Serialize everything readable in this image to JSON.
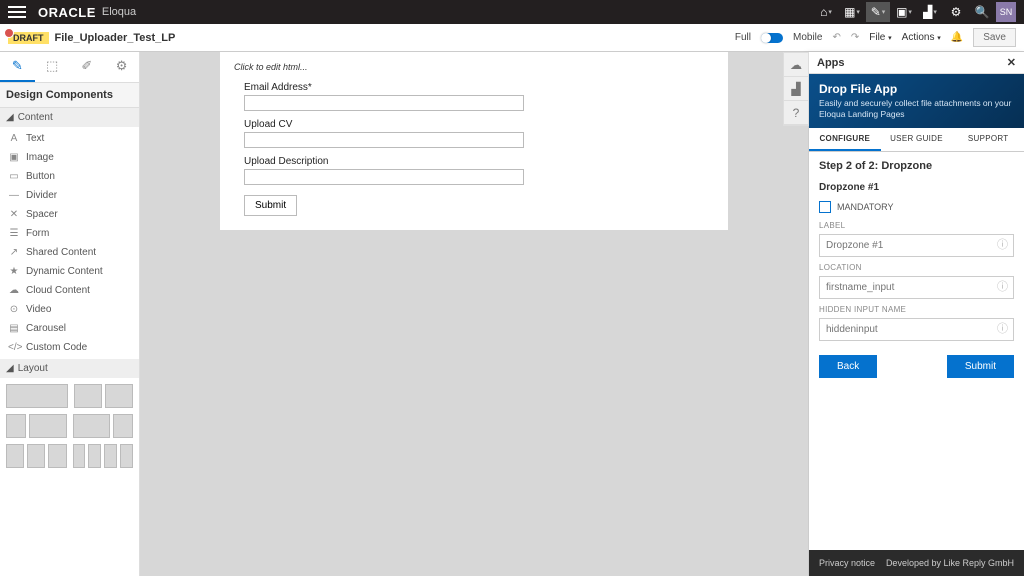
{
  "header": {
    "brand": "ORACLE",
    "product": "Eloqua",
    "user_initials": "SN"
  },
  "subheader": {
    "status": "DRAFT",
    "page_name": "File_Uploader_Test_LP",
    "view_full": "Full",
    "view_mobile": "Mobile",
    "menu_file": "File",
    "menu_actions": "Actions",
    "save": "Save"
  },
  "sidebar": {
    "title": "Design Components",
    "sections": {
      "content": "Content",
      "layout": "Layout"
    },
    "items": [
      "Text",
      "Image",
      "Button",
      "Divider",
      "Spacer",
      "Form",
      "Shared Content",
      "Dynamic Content",
      "Cloud Content",
      "Video",
      "Carousel",
      "Custom Code"
    ],
    "item_icons": [
      "A",
      "▣",
      "▭",
      "—",
      "✕",
      "☰",
      "↗",
      "★",
      "☁",
      "⊙",
      "▤",
      "</>"
    ]
  },
  "form": {
    "hint": "Click to edit html...",
    "fields": {
      "email": "Email Address*",
      "cv": "Upload CV",
      "desc": "Upload Description"
    },
    "submit": "Submit"
  },
  "apps": {
    "title": "Apps",
    "hero_title": "Drop File App",
    "hero_desc": "Easily and securely collect file attachments on your Eloqua Landing Pages",
    "tabs": {
      "configure": "CONFIGURE",
      "guide": "USER GUIDE",
      "support": "SUPPORT"
    },
    "step_title": "Step 2 of 2: Dropzone",
    "dz_title": "Dropzone #1",
    "mandatory": "MANDATORY",
    "label_label": "LABEL",
    "label_ph": "Dropzone #1",
    "location_label": "LOCATION",
    "location_ph": "firstname_input",
    "hidden_label": "HIDDEN INPUT NAME",
    "hidden_ph": "hiddeninput",
    "back": "Back",
    "submit": "Submit",
    "privacy": "Privacy notice",
    "credit": "Developed by Like Reply GmbH"
  }
}
